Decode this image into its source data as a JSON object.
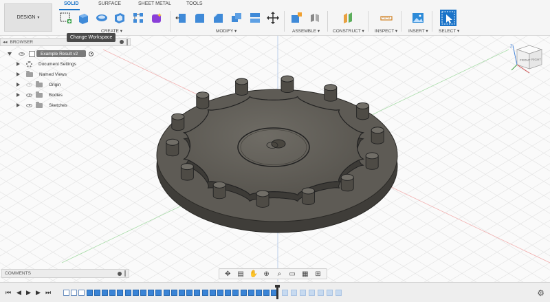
{
  "workspace": {
    "label": "DESIGN",
    "caret": "▾"
  },
  "tabs": [
    {
      "label": "SOLID",
      "active": true
    },
    {
      "label": "SURFACE",
      "active": false
    },
    {
      "label": "SHEET METAL",
      "active": false
    },
    {
      "label": "TOOLS",
      "active": false
    }
  ],
  "toolbar_groups": {
    "create": "CREATE ▾",
    "modify": "MODIFY ▾",
    "assemble": "ASSEMBLE ▾",
    "construct": "CONSTRUCT ▾",
    "inspect": "INSPECT ▾",
    "insert": "INSERT ▾",
    "select": "SELECT ▾"
  },
  "tooltip": "Change Workspace",
  "browser": {
    "title": "BROWSER",
    "collapse_icon": "◂◂",
    "items": [
      {
        "label": "Example Result v2",
        "icon": "document-icon",
        "active": true
      },
      {
        "label": "Document Settings",
        "icon": "gear-icon"
      },
      {
        "label": "Named Views",
        "icon": "folder-icon"
      },
      {
        "label": "Origin",
        "icon": "folder-icon",
        "hidden": true
      },
      {
        "label": "Bodies",
        "icon": "folder-icon"
      },
      {
        "label": "Sketches",
        "icon": "folder-icon"
      }
    ]
  },
  "comments": {
    "title": "COMMENTS"
  },
  "viewcube": {
    "front": "FRONT",
    "right": "RIGHT"
  },
  "axis_label": "Z",
  "timeline": {
    "controls": [
      "⏮",
      "◀",
      "▶",
      "▶",
      "⏭"
    ]
  },
  "colors": {
    "accent": "#1a73c8",
    "part_fill": "#5a5750",
    "part_top": "#6a6760",
    "part_edge": "#2a2926",
    "grid": "#e2e2e2"
  }
}
